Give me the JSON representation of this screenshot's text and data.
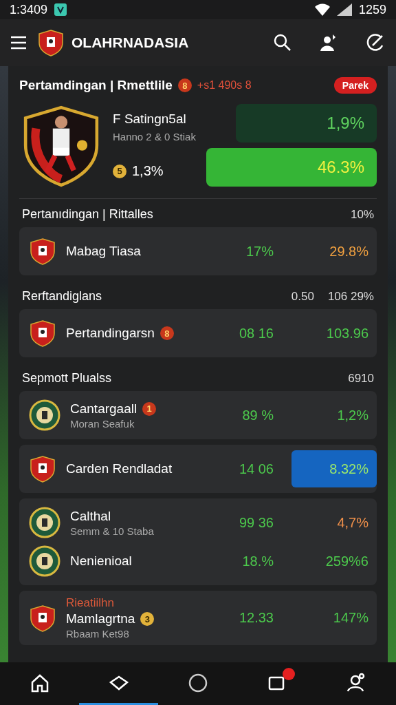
{
  "status_bar": {
    "time": "1:3409",
    "battery": "1259"
  },
  "app_bar": {
    "title": "OLAHRNADASIA"
  },
  "featured": {
    "title": "Pertamdingan | Rmettlile",
    "badge": "8",
    "note": "+s1 490s 8",
    "tag": "Parek",
    "team": "F Satingn5al",
    "sub": "Hanno 2 & 0 Stiak",
    "rank": "5",
    "share": "1,3%",
    "odds": [
      {
        "text": "1,9%",
        "selected": false
      },
      {
        "text": "46.3%",
        "selected": true
      }
    ]
  },
  "sections": [
    {
      "title": "Pertanıdingan | Rittalles",
      "value": "10%",
      "cards": [
        {
          "teams": [
            {
              "kind": "shield",
              "name": "Mabag Tiasa",
              "odds": [
                {
                  "text": "17%",
                  "color": "#4cc94c",
                  "selected": false
                },
                {
                  "text": "29.8%",
                  "color": "#f0a040",
                  "selected": false
                }
              ]
            }
          ]
        }
      ]
    },
    {
      "title": "Rerftandiglans",
      "value": "106 29%",
      "values": [
        "0.50"
      ],
      "cards": [
        {
          "teams": [
            {
              "kind": "shield",
              "name": "Pertandingarsn",
              "badge": "8",
              "odds": [
                {
                  "text": "08 16",
                  "color": "#4cc94c",
                  "selected": false
                },
                {
                  "text": "103.96",
                  "color": "#4cc94c",
                  "selected": false
                }
              ]
            }
          ]
        }
      ]
    },
    {
      "title": "Sepmott Plualss",
      "value": "6910",
      "cards": [
        {
          "teams": [
            {
              "kind": "round",
              "name": "Cantargaall",
              "badge": "1",
              "sub": "Moran Seafuk",
              "odds": [
                {
                  "text": "89 %",
                  "color": "#4cc94c",
                  "selected": false
                },
                {
                  "text": "1,2%",
                  "color": "#4cc94c",
                  "selected": false
                }
              ]
            }
          ]
        },
        {
          "teams": [
            {
              "kind": "shield",
              "name": "Carden Rendladat",
              "odds": [
                {
                  "text": "14 06",
                  "color": "#4cc94c",
                  "selected": false
                },
                {
                  "text": "8.32%",
                  "color": "#9be86a",
                  "selected": true
                }
              ]
            }
          ]
        },
        {
          "teams": [
            {
              "kind": "round",
              "name": "Calthal",
              "sub": "Semm & 10 Staba",
              "odds": [
                {
                  "text": "99 36",
                  "color": "#4cc94c",
                  "selected": false
                },
                {
                  "text": "4,7%",
                  "color": "#f0904a",
                  "selected": false
                }
              ]
            },
            {
              "kind": "round",
              "name": "Nenienioal",
              "odds": [
                {
                  "text": "18.%",
                  "color": "#4cc94c",
                  "selected": false
                },
                {
                  "text": "259%6",
                  "color": "#4cc94c",
                  "selected": false
                }
              ]
            }
          ]
        },
        {
          "teams": [
            {
              "kind": "shield",
              "tag": "Rieatiilhn",
              "name": "Mamlagrtna",
              "badge": "3",
              "sub": "Rbaam Ket98",
              "odds": [
                {
                  "text": "12.33",
                  "color": "#4cc94c",
                  "selected": false
                },
                {
                  "text": "147%",
                  "color": "#4cc94c",
                  "selected": false
                }
              ]
            }
          ]
        }
      ]
    }
  ],
  "nav": [
    {
      "kind": "home",
      "selected": false,
      "alert": false
    },
    {
      "kind": "diamond",
      "selected": true,
      "alert": false
    },
    {
      "kind": "circle",
      "selected": false,
      "alert": false
    },
    {
      "kind": "square",
      "selected": false,
      "alert": true
    },
    {
      "kind": "user",
      "selected": false,
      "alert": false
    }
  ]
}
